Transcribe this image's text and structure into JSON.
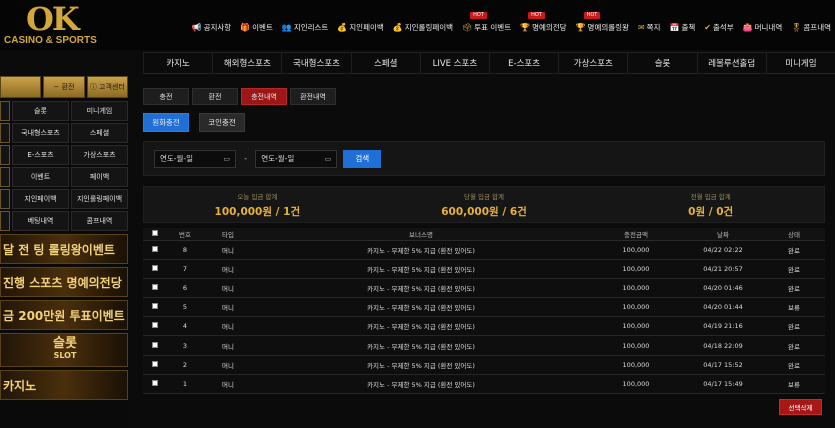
{
  "logo": {
    "main": "OK",
    "sub": "CASINO & SPORTS"
  },
  "topnav": [
    {
      "label": "공지사항",
      "icon": "megaphone-icon",
      "glyph": "📢",
      "hot": ""
    },
    {
      "label": "이벤트",
      "icon": "gift-icon",
      "glyph": "🎁",
      "hot": ""
    },
    {
      "label": "지인리스트",
      "icon": "users-icon",
      "glyph": "👥",
      "hot": ""
    },
    {
      "label": "지인페이백",
      "icon": "coin-icon",
      "glyph": "💰",
      "hot": ""
    },
    {
      "label": "지인롤링페이백",
      "icon": "coin-icon",
      "glyph": "💰",
      "hot": ""
    },
    {
      "label": "투표 이벤트",
      "icon": "vote-icon",
      "glyph": "🗳",
      "hot": "HOT"
    },
    {
      "label": "명예의전당",
      "icon": "trophy-icon",
      "glyph": "🏆",
      "hot": "HOT"
    },
    {
      "label": "명예의롤링왕",
      "icon": "trophy-icon",
      "glyph": "🏆",
      "hot": "HOT"
    },
    {
      "label": "쪽지",
      "icon": "mail-icon",
      "glyph": "✉",
      "hot": ""
    },
    {
      "label": "출첵",
      "icon": "calendar-icon",
      "glyph": "📅",
      "hot": ""
    },
    {
      "label": "출석부",
      "icon": "check-icon",
      "glyph": "✔",
      "hot": ""
    },
    {
      "label": "머니내역",
      "icon": "wallet-icon",
      "glyph": "👛",
      "hot": ""
    },
    {
      "label": "콤프내역",
      "icon": "comp-icon",
      "glyph": "🎖",
      "hot": ""
    }
  ],
  "mainnav": [
    "카지노",
    "해외형스포츠",
    "국내형스포츠",
    "스페셜",
    "LIVE 스포츠",
    "E-스포츠",
    "가상스포츠",
    "슬롯",
    "레볼루션홀덤",
    "미니게임"
  ],
  "sidebar": {
    "head": [
      "",
      "환전",
      "고객센터"
    ],
    "grid": [
      [
        "",
        "슬롯",
        "미니게임"
      ],
      [
        "",
        "국내형스포츠",
        "스페셜"
      ],
      [
        "",
        "E-스포츠",
        "가상스포츠"
      ],
      [
        "",
        "이벤트",
        "페이백"
      ],
      [
        "",
        "지인페이백",
        "지인롤링페이백"
      ],
      [
        "",
        "베팅내역",
        "콤프내역"
      ]
    ],
    "banners": [
      "달 전 팅 롤링왕이벤트",
      "진행 스포츠 명예의전당",
      "금 200만원 투표이벤트"
    ],
    "slot": {
      "main": "슬롯",
      "sub": "SLOT"
    },
    "casino": "카지노"
  },
  "tabs": [
    {
      "label": "충전",
      "active": false
    },
    {
      "label": "환전",
      "active": false
    },
    {
      "label": "충전내역",
      "active": true
    },
    {
      "label": "환전내역",
      "active": false
    }
  ],
  "subtabs": [
    {
      "label": "원화충전",
      "active": true
    },
    {
      "label": "코인충전",
      "active": false
    }
  ],
  "filter": {
    "from": "연도-월-일",
    "to": "연도-월-일",
    "dash": "-",
    "search": "검색"
  },
  "summary": [
    {
      "label": "오늘 입금 합계",
      "value": "100,000원 / 1건"
    },
    {
      "label": "당월 입금 합계",
      "value": "600,000원 / 6건"
    },
    {
      "label": "전월 입금 합계",
      "value": "0원 / 0건"
    }
  ],
  "table": {
    "headers": [
      "번호",
      "타입",
      "보너스명",
      "충전금액",
      "날짜",
      "상태"
    ],
    "rows": [
      {
        "no": "8",
        "type": "머니",
        "bonus": "카지노 - 무제한 5% 지급 (환전 있어도)",
        "amount": "100,000",
        "date": "04/22 02:22",
        "status": "완료"
      },
      {
        "no": "7",
        "type": "머니",
        "bonus": "카지노 - 무제한 5% 지급 (환전 있어도)",
        "amount": "100,000",
        "date": "04/21 20:57",
        "status": "완료"
      },
      {
        "no": "6",
        "type": "머니",
        "bonus": "카지노 - 무제한 5% 지급 (환전 있어도)",
        "amount": "100,000",
        "date": "04/20 01:46",
        "status": "완료"
      },
      {
        "no": "5",
        "type": "머니",
        "bonus": "카지노 - 무제한 5% 지급 (환전 있어도)",
        "amount": "100,000",
        "date": "04/20 01:44",
        "status": "보류"
      },
      {
        "no": "4",
        "type": "머니",
        "bonus": "카지노 - 무제한 5% 지급 (환전 있어도)",
        "amount": "100,000",
        "date": "04/19 21:16",
        "status": "완료"
      },
      {
        "no": "3",
        "type": "머니",
        "bonus": "카지노 - 무제한 5% 지급 (환전 있어도)",
        "amount": "100,000",
        "date": "04/18 22:09",
        "status": "완료"
      },
      {
        "no": "2",
        "type": "머니",
        "bonus": "카지노 - 무제한 5% 지급 (환전 있어도)",
        "amount": "100,000",
        "date": "04/17 15:52",
        "status": "완료"
      },
      {
        "no": "1",
        "type": "머니",
        "bonus": "카지노 - 무제한 5% 지급 (환전 있어도)",
        "amount": "100,000",
        "date": "04/17 15:49",
        "status": "보류"
      }
    ]
  },
  "delete_selected": "선택삭제",
  "colors": {
    "gold": "#d4a73c",
    "red": "#9c1818",
    "blue": "#1f6fd6"
  }
}
